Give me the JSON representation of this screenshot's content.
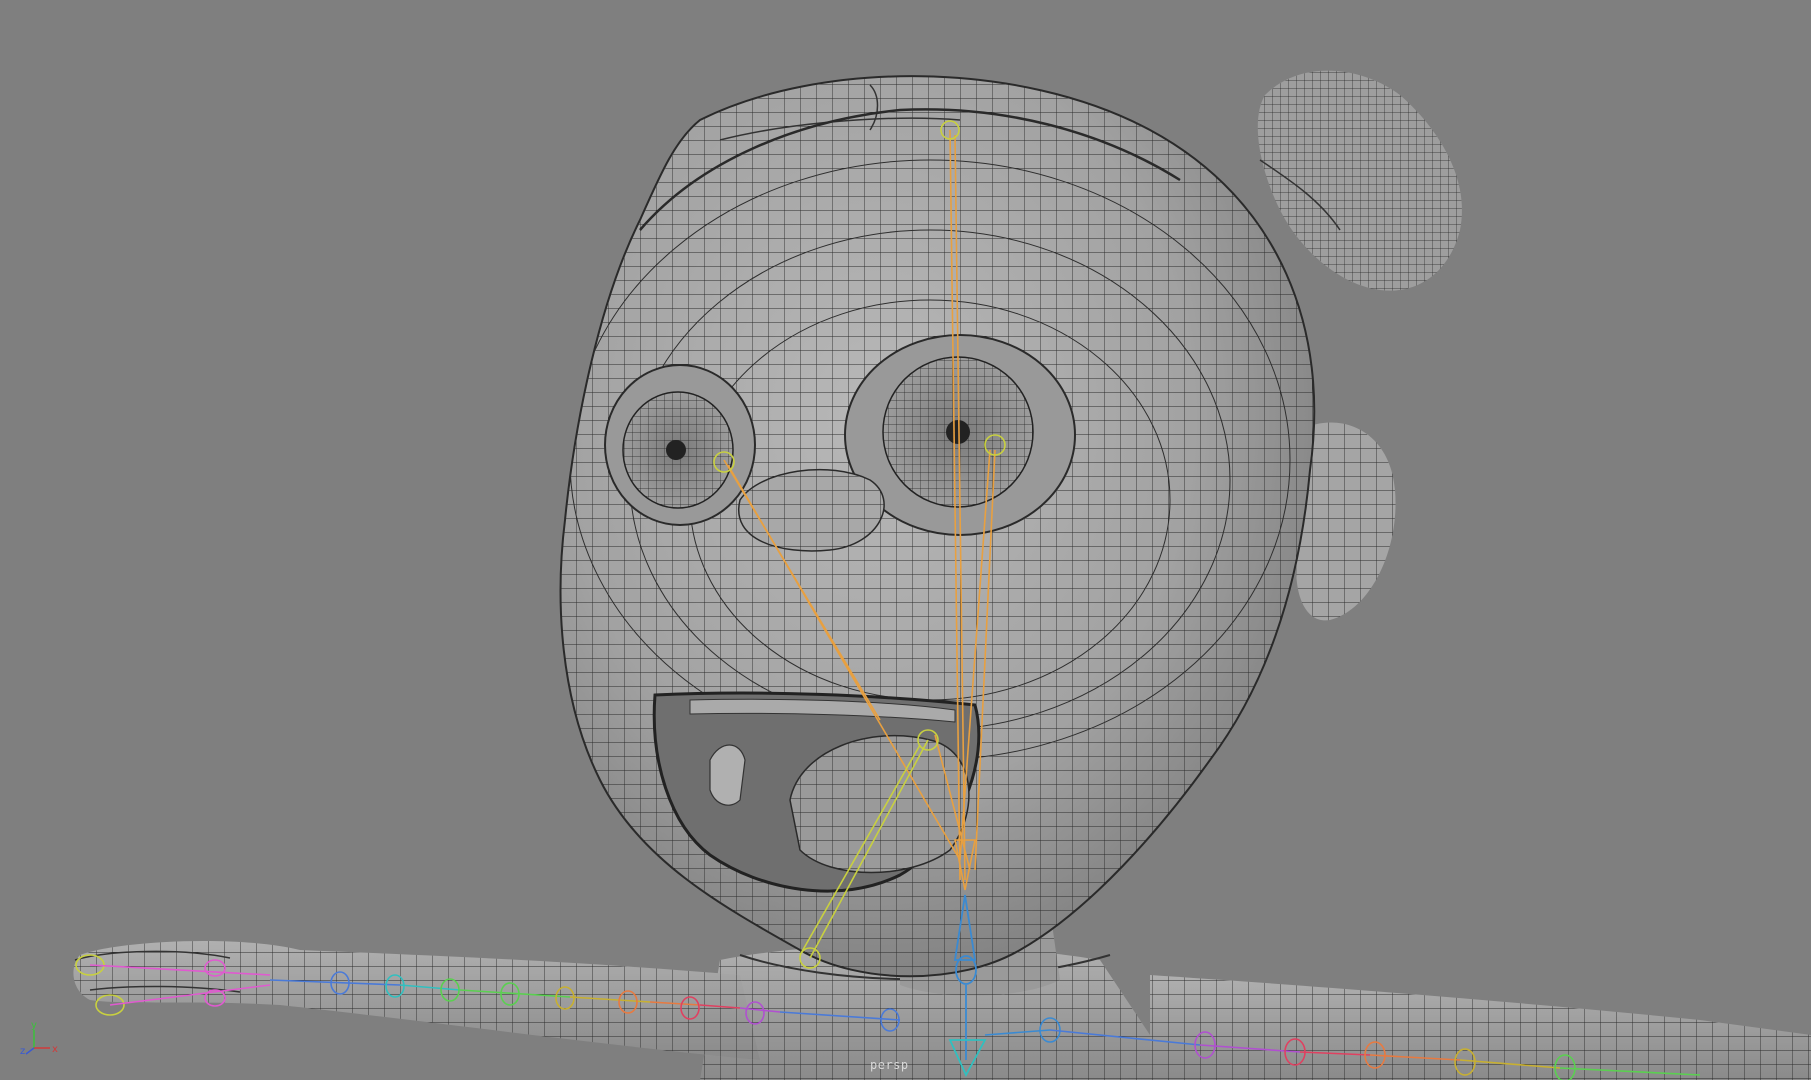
{
  "viewport": {
    "camera_name": "persp",
    "background": "#7f7f7f",
    "shading": "wireframe-on-shaded"
  },
  "axis_gizmo": {
    "x_label": "x",
    "y_label": "y",
    "z_label": "z",
    "x_color": "#d23a3a",
    "y_color": "#3ac23a",
    "z_color": "#3a5ad2"
  },
  "rig": {
    "head_joint_color": "#e8a040",
    "locator_color": "#c8d040",
    "neck_joint_color": "#3a8ad2"
  }
}
